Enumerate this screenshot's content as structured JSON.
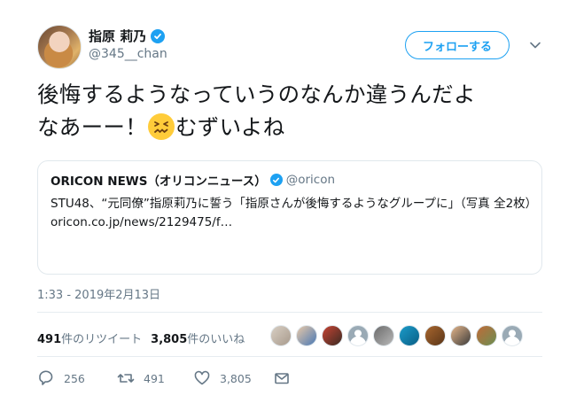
{
  "author": {
    "display_name": "指原 莉乃",
    "handle": "@345__chan",
    "verified": true
  },
  "follow_button": {
    "label": "フォローする"
  },
  "tweet": {
    "text_line1": "後悔するようなっていうのなんか違うんだよ",
    "text_line2_before_emoji": "なあーー！",
    "emoji_name": "confounded-face",
    "text_line2_after_emoji": "むずいよね"
  },
  "quoted_tweet": {
    "name": "ORICON NEWS（オリコンニュース）",
    "verified": true,
    "handle": "@oricon",
    "body": "STU48、“元同僚”指原莉乃に誓う「指原さんが後悔するようなグループに」（写真 全2枚）",
    "link": "oricon.co.jp/news/2129475/f…"
  },
  "timestamp": "1:33 - 2019年2月13日",
  "stats": {
    "retweets_count": "491",
    "retweets_label": "件のリツイート",
    "likes_count": "3,805",
    "likes_label": "件のいいね"
  },
  "actions": {
    "reply_count": "256",
    "retweet_count": "491",
    "like_count": "3,805"
  },
  "colors": {
    "accent": "#1da1f2",
    "text": "#14171a",
    "secondary": "#657786",
    "border": "#e1e8ed"
  }
}
